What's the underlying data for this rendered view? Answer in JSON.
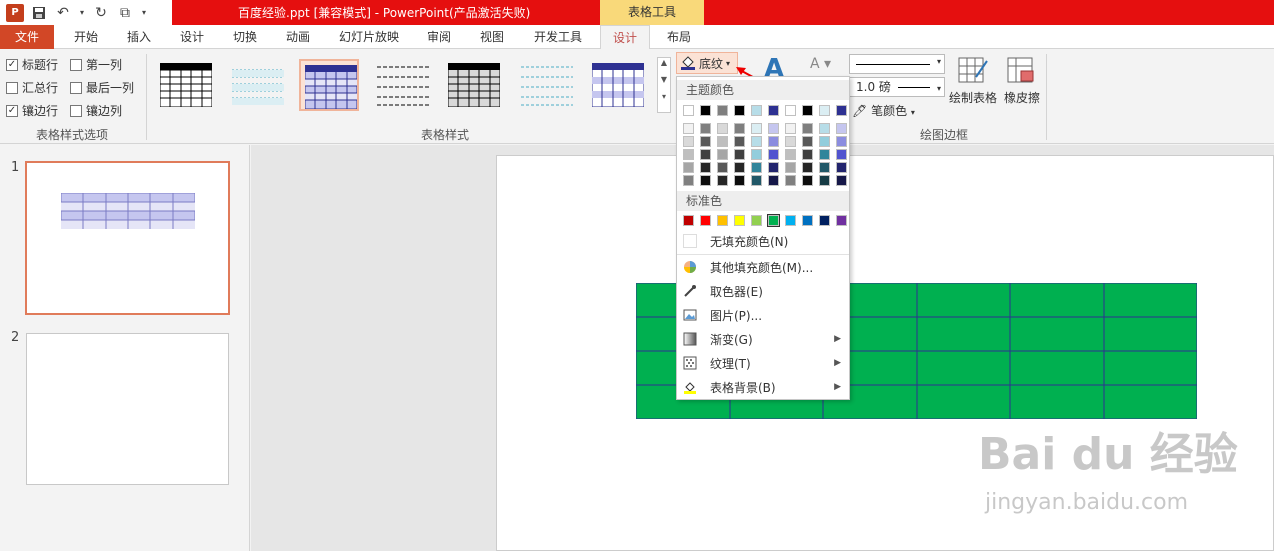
{
  "window": {
    "title": "百度经验.ppt [兼容模式] -  PowerPoint(产品激活失败)",
    "contextual_tab_group": "表格工具"
  },
  "tabs": [
    "文件",
    "开始",
    "插入",
    "设计",
    "切换",
    "动画",
    "幻灯片放映",
    "审阅",
    "视图",
    "开发工具",
    "设计",
    "布局"
  ],
  "table_style_options": {
    "group_label": "表格样式选项",
    "items": [
      {
        "label": "标题行",
        "checked": true
      },
      {
        "label": "第一列",
        "checked": false
      },
      {
        "label": "汇总行",
        "checked": false
      },
      {
        "label": "最后一列",
        "checked": false
      },
      {
        "label": "镶边行",
        "checked": true
      },
      {
        "label": "镶边列",
        "checked": false
      }
    ]
  },
  "table_styles": {
    "group_label": "表格样式"
  },
  "shading": {
    "button_label": "底纹"
  },
  "draw_borders": {
    "group_label": "绘图边框",
    "pen_weight": "1.0 磅",
    "pen_color_label": "笔颜色",
    "draw_table_label": "绘制表格",
    "eraser_label": "橡皮擦"
  },
  "slides": {
    "numbers": [
      "1",
      "2"
    ]
  },
  "dropdown": {
    "theme_colors_label": "主题颜色",
    "standard_colors_label": "标准色",
    "theme_top_row": [
      "#ffffff",
      "#000000",
      "#7f7f7f",
      "#000000",
      "#b7dde8",
      "#2e3192",
      "#ffffff",
      "#000000",
      "#dbeef3",
      "#2e3192"
    ],
    "theme_shade_columns": [
      [
        "#f2f2f2",
        "#d9d9d9",
        "#bfbfbf",
        "#a6a6a6",
        "#808080"
      ],
      [
        "#7f7f7f",
        "#595959",
        "#404040",
        "#262626",
        "#0d0d0d"
      ],
      [
        "#d9d9d9",
        "#bfbfbf",
        "#a6a6a6",
        "#595959",
        "#262626"
      ],
      [
        "#7f7f7f",
        "#595959",
        "#404040",
        "#262626",
        "#0d0d0d"
      ],
      [
        "#dbeef3",
        "#b7dde8",
        "#92cddc",
        "#31859b",
        "#215868"
      ],
      [
        "#c5c6ef",
        "#8b8ddf",
        "#5154cf",
        "#22246d",
        "#161849"
      ],
      [
        "#f2f2f2",
        "#d9d9d9",
        "#bfbfbf",
        "#a6a6a6",
        "#808080"
      ],
      [
        "#7f7f7f",
        "#595959",
        "#404040",
        "#262626",
        "#0d0d0d"
      ],
      [
        "#b7dde8",
        "#92cddc",
        "#31859b",
        "#215868",
        "#163b45"
      ],
      [
        "#c5c6ef",
        "#8b8ddf",
        "#5154cf",
        "#22246d",
        "#161849"
      ]
    ],
    "standard_colors": [
      "#c00000",
      "#ff0000",
      "#ffc000",
      "#ffff00",
      "#92d050",
      "#00b050",
      "#00b0f0",
      "#0070c0",
      "#002060",
      "#7030a0"
    ],
    "no_fill": "无填充颜色(N)",
    "items": [
      {
        "label": "其他填充颜色(M)...",
        "submenu": false
      },
      {
        "label": "取色器(E)",
        "submenu": false
      },
      {
        "label": "图片(P)...",
        "submenu": false
      },
      {
        "label": "渐变(G)",
        "submenu": true
      },
      {
        "label": "纹理(T)",
        "submenu": true
      },
      {
        "label": "表格背景(B)",
        "submenu": true
      }
    ]
  },
  "colors": {
    "title_bar_red": "#e50f0f",
    "file_tab": "#d24726",
    "table_green": "#00b050",
    "table_border": "#2e3192",
    "selected_style_border": "#f0b49a"
  },
  "watermark": {
    "logo_text": "Bai du 经验",
    "url": "jingyan.baidu.com"
  }
}
